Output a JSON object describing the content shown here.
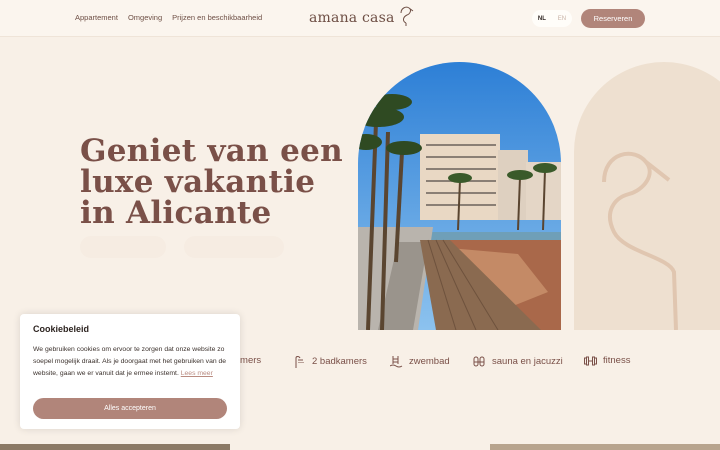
{
  "nav": {
    "links": [
      "Appartement",
      "Omgeving",
      "Prijzen en beschikbaarheid"
    ]
  },
  "logo": {
    "text": "amana casa",
    "icon": "flamingo-icon"
  },
  "lang": {
    "active": "NL",
    "inactive": "EN"
  },
  "header": {
    "reserve_label": "Reserveren"
  },
  "hero": {
    "title_lines": [
      "Geniet van een",
      "luxe vakantie",
      "in Alicante"
    ]
  },
  "amenities": [
    {
      "label": "kamers",
      "icon": "bed-icon"
    },
    {
      "label": "2 badkamers",
      "icon": "shower-icon"
    },
    {
      "label": "zwembad",
      "icon": "pool-icon"
    },
    {
      "label": "sauna en jacuzzi",
      "icon": "sauna-icon"
    },
    {
      "label": "fitness",
      "icon": "dumbbell-icon"
    }
  ],
  "cookie": {
    "title": "Cookiebeleid",
    "text": "We gebruiken cookies om ervoor te zorgen dat onze website zo soepel mogelijk draait. Als je doorgaat met het gebruiken van de website, gaan we er vanuit dat je ermee instemt.",
    "more_link": "Lees meer",
    "accept_label": "Alles accepteren"
  },
  "colors": {
    "background": "#f8f0e7",
    "accent": "#b1857a",
    "text": "#7a5048"
  }
}
